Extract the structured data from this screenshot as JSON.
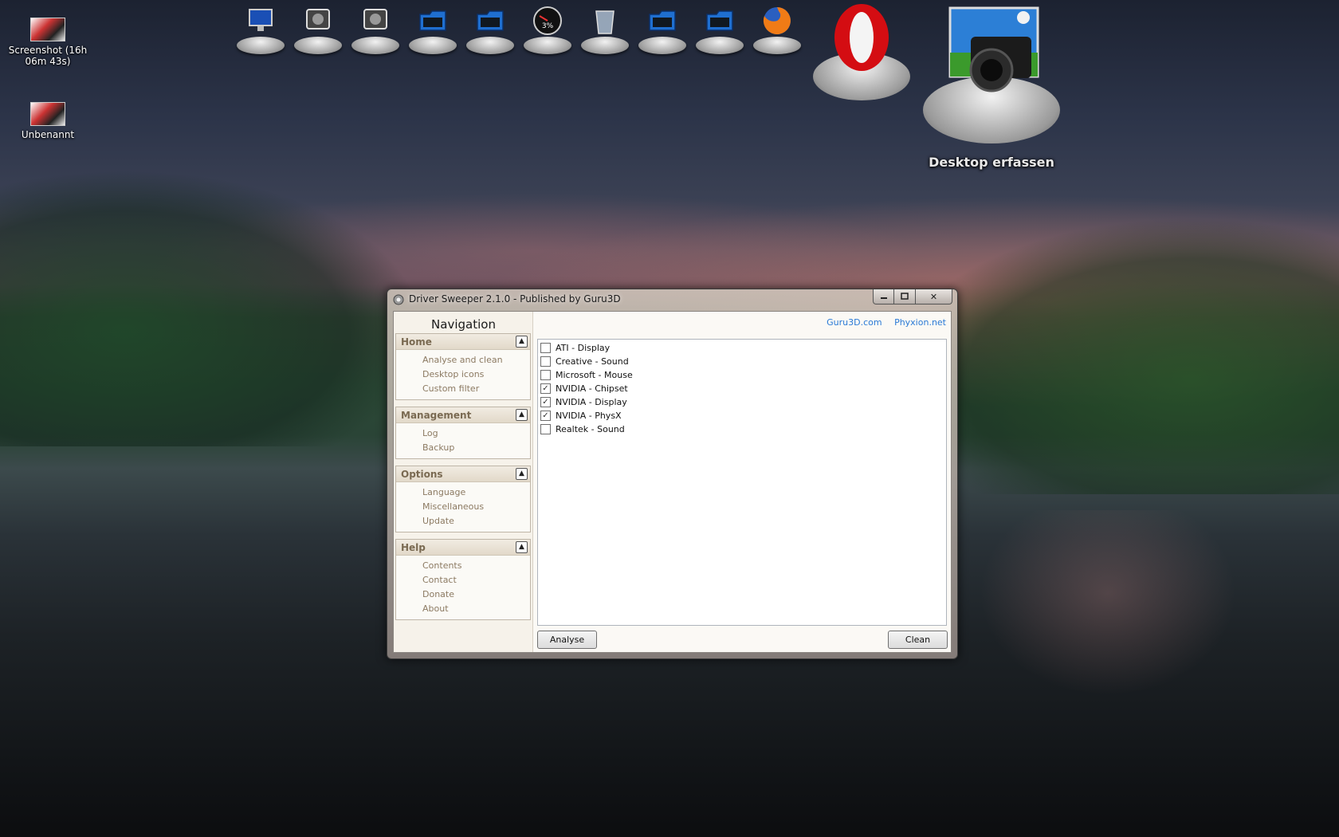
{
  "desktop": {
    "icons": [
      {
        "label": "Screenshot (16h 06m 43s)",
        "icon": "image-file-icon"
      },
      {
        "label": "Unbenannt",
        "icon": "image-file-icon"
      }
    ],
    "dock": [
      {
        "icon": "computer-icon"
      },
      {
        "icon": "hard-drive-icon"
      },
      {
        "icon": "hard-drive-icon"
      },
      {
        "icon": "folder-icon"
      },
      {
        "icon": "folder-icon"
      },
      {
        "icon": "cpu-meter-icon",
        "text": "3%"
      },
      {
        "icon": "recycle-bin-icon"
      },
      {
        "icon": "folder-icon"
      },
      {
        "icon": "folder-icon"
      },
      {
        "icon": "firefox-icon"
      },
      {
        "icon": "opera-icon"
      },
      {
        "icon": "camera-icon"
      }
    ],
    "capture_label": "Desktop erfassen"
  },
  "window": {
    "title": "Driver Sweeper 2.1.0 - Published by Guru3D",
    "controls": {
      "minimize": "minimize-icon",
      "maximize": "maximize-icon",
      "close": "✕"
    },
    "navigation": {
      "title": "Navigation",
      "panels": [
        {
          "header": "Home",
          "items": [
            "Analyse and clean",
            "Desktop icons",
            "Custom filter"
          ]
        },
        {
          "header": "Management",
          "items": [
            "Log",
            "Backup"
          ]
        },
        {
          "header": "Options",
          "items": [
            "Language",
            "Miscellaneous",
            "Update"
          ]
        },
        {
          "header": "Help",
          "items": [
            "Contents",
            "Contact",
            "Donate",
            "About"
          ]
        }
      ]
    },
    "links": [
      "Guru3D.com",
      "Phyxion.net"
    ],
    "drivers": [
      {
        "label": "ATI - Display",
        "checked": false
      },
      {
        "label": "Creative - Sound",
        "checked": false
      },
      {
        "label": "Microsoft - Mouse",
        "checked": false
      },
      {
        "label": "NVIDIA - Chipset",
        "checked": true
      },
      {
        "label": "NVIDIA - Display",
        "checked": true
      },
      {
        "label": "NVIDIA - PhysX",
        "checked": true
      },
      {
        "label": "Realtek - Sound",
        "checked": false
      }
    ],
    "buttons": {
      "analyse": "Analyse",
      "clean": "Clean"
    }
  },
  "colors": {
    "link": "#2a7ad6",
    "nav_item": "#8c7a62",
    "nav_header": "#7a6a52"
  }
}
